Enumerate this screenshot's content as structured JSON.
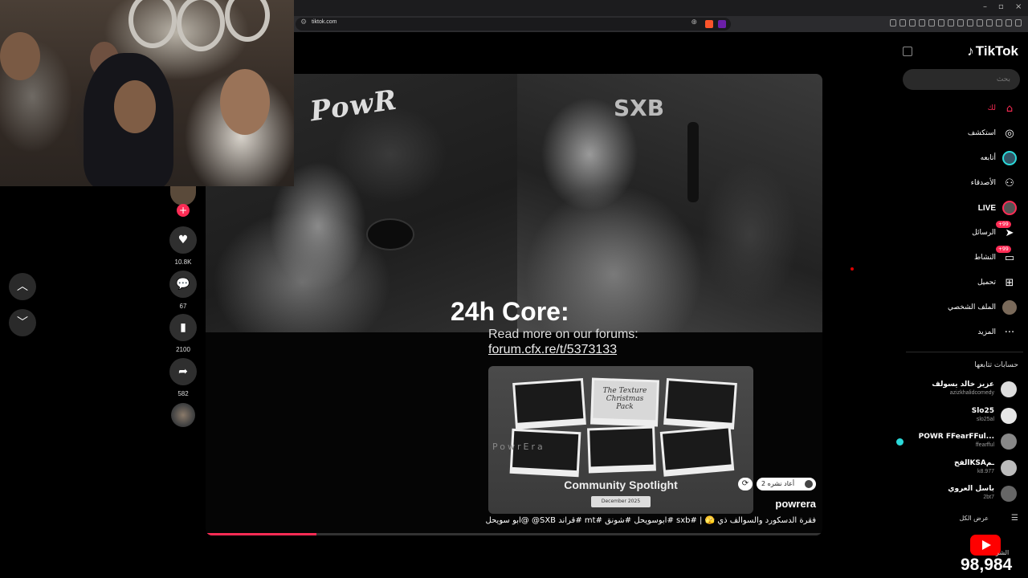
{
  "browser": {
    "url": "tiktok.com",
    "window_controls": [
      "–",
      "▫",
      "×"
    ]
  },
  "tiktok": {
    "logo": "TikTok",
    "search_placeholder": "بحث",
    "nav": [
      {
        "label": "لك",
        "icon": "home-icon",
        "glyph": "⌂",
        "active": true
      },
      {
        "label": "استكشف",
        "icon": "compass-icon",
        "glyph": "◎",
        "active": false
      },
      {
        "label": "أتابعه",
        "icon": "following-avatar-icon",
        "glyph": "●",
        "active": false
      },
      {
        "label": "الأصدقاء",
        "icon": "friends-icon",
        "glyph": "👥",
        "active": false
      },
      {
        "label": "LIVE",
        "icon": "live-icon",
        "glyph": "●",
        "active": false
      },
      {
        "label": "الرسائل",
        "icon": "messages-icon",
        "glyph": "➤",
        "badge": "+99"
      },
      {
        "label": "النشاط",
        "icon": "activity-icon",
        "glyph": "▭",
        "badge": "+99"
      },
      {
        "label": "تحميل",
        "icon": "upload-icon",
        "glyph": "⊞"
      },
      {
        "label": "الملف الشخصي",
        "icon": "profile-avatar-icon",
        "glyph": "●"
      },
      {
        "label": "المزيد",
        "icon": "more-icon",
        "glyph": "···"
      }
    ],
    "following_title": "حسابات تتابعها",
    "following": [
      {
        "name": "عزيز خالد يسولف",
        "handle": "azizkhalidcomedy",
        "live": false
      },
      {
        "name": "Slo25",
        "handle": "slo25al",
        "live": false
      },
      {
        "name": "POWR FFearFFul...",
        "handle": "ffearfful",
        "live": true
      },
      {
        "name": "الفخKSAـم",
        "handle": "k8.977",
        "live": false
      },
      {
        "name": "باسل العروي",
        "handle": "2bt7",
        "live": false
      }
    ],
    "see_all": "عرض الكل"
  },
  "video": {
    "headline": "24h Core:",
    "read_more": "Read more on our forums:",
    "forum_link": "forum.cfx.re/t/5373133",
    "logo_left": "PowR",
    "logo_right": "SXB",
    "spotlight_title": "Community Spotlight",
    "spotlight_date": "December 2025",
    "spotlight_texture": "The Texture Christmas Pack",
    "spotlight_watermark": "PowrEra",
    "repost_text": "2 أعاد نشره",
    "username": "powrera",
    "caption": "فقرة الدسكورد والسوالف ذي 🫣 | #sxb #ابوسويحل #شونق #mt #قراند SXB@ @ابو سويحل",
    "progress": 0.18
  },
  "actions": {
    "likes": "10.8K",
    "comments": "67",
    "saves": "2100",
    "shares": "582"
  },
  "overlay": {
    "yt_label": "الشر",
    "viewer_count": "98,984"
  },
  "colors": {
    "accent": "#fe2c55",
    "live_dot": "#2bd9d9",
    "youtube": "#ff0000"
  }
}
